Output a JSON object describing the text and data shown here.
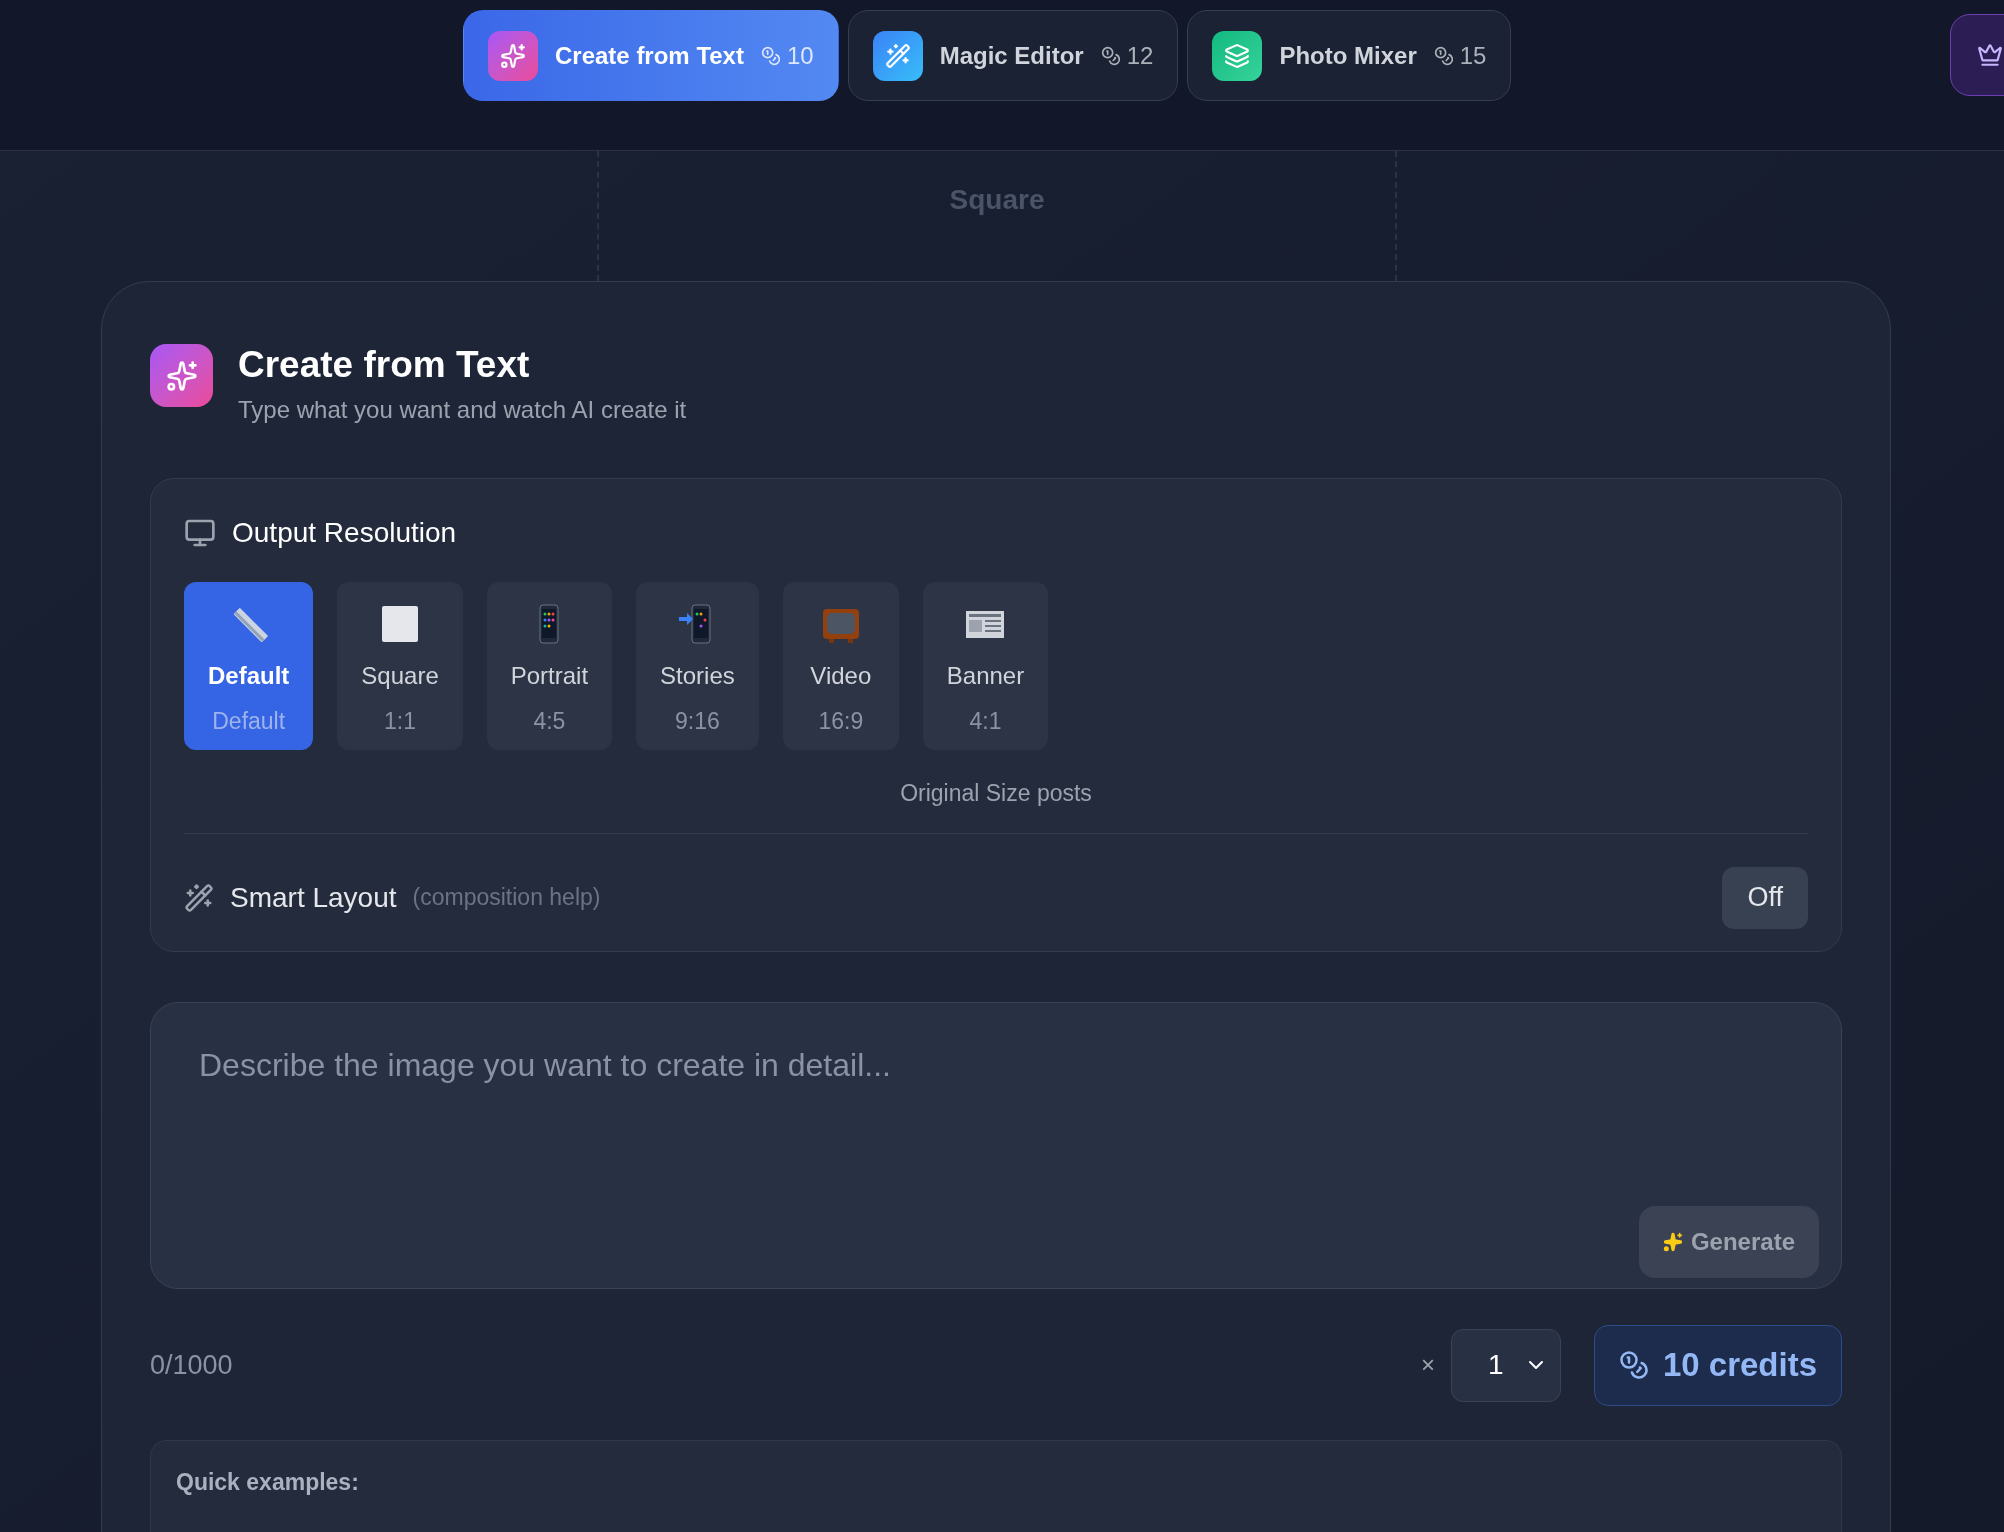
{
  "tabs": [
    {
      "label": "Create from Text",
      "cost": "10",
      "kind": "sparkles",
      "selected": true
    },
    {
      "label": "Magic Editor",
      "cost": "12",
      "kind": "wand",
      "selected": false
    },
    {
      "label": "Photo Mixer",
      "cost": "15",
      "kind": "layers",
      "selected": false
    }
  ],
  "backdrop": {
    "label": "Square"
  },
  "card": {
    "title": "Create from Text",
    "subtitle": "Type what you want and watch AI create it",
    "resolution": {
      "title": "Output Resolution",
      "options": [
        {
          "kind": "ruler",
          "label": "Default",
          "ratio": "Default",
          "selected": true
        },
        {
          "kind": "square",
          "label": "Square",
          "ratio": "1:1",
          "selected": false
        },
        {
          "kind": "phone",
          "label": "Portrait",
          "ratio": "4:5",
          "selected": false
        },
        {
          "kind": "phone-arrow",
          "label": "Stories",
          "ratio": "9:16",
          "selected": false
        },
        {
          "kind": "tv",
          "label": "Video",
          "ratio": "16:9",
          "selected": false
        },
        {
          "kind": "newspaper",
          "label": "Banner",
          "ratio": "4:1",
          "selected": false
        }
      ],
      "caption": "Original Size posts"
    },
    "smart_layout": {
      "label": "Smart Layout",
      "hint": "(composition help)",
      "button": "Off",
      "on": false
    },
    "prompt": {
      "placeholder": "Describe the image you want to create in detail...",
      "generate": "Generate",
      "disabled": true
    },
    "counter": "0/1000",
    "times": "×",
    "quantity": "1",
    "credits": "10 credits",
    "examples": {
      "title": "Quick examples:"
    }
  }
}
